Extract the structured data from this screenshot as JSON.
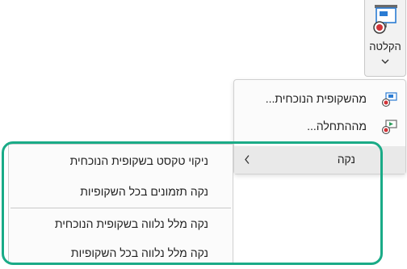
{
  "ribbon": {
    "record_label": "הקלטה",
    "icons": {
      "record": "record-slide-icon",
      "chevron": "chevron-down-icon"
    }
  },
  "menu": {
    "items": [
      {
        "label": "מהשקופית הנוכחית...",
        "icon": "record-from-current-icon"
      },
      {
        "label": "מההתחלה...",
        "icon": "record-from-beginning-icon"
      },
      {
        "label": "נקה",
        "icon": "chevron-left-icon"
      }
    ]
  },
  "submenu": {
    "items": [
      {
        "label": "ניקוי טקסט בשקופית הנוכחית"
      },
      {
        "label": "נקה תזמונים בכל השקופיות"
      },
      {
        "label": "נקה מלל נלווה בשקופית הנוכחית"
      },
      {
        "label": "נקה מלל נלווה בכל השקופיות"
      }
    ]
  },
  "colors": {
    "highlight": "#1aab87",
    "record_red": "#d13438",
    "accent_blue": "#2b7cd3"
  }
}
